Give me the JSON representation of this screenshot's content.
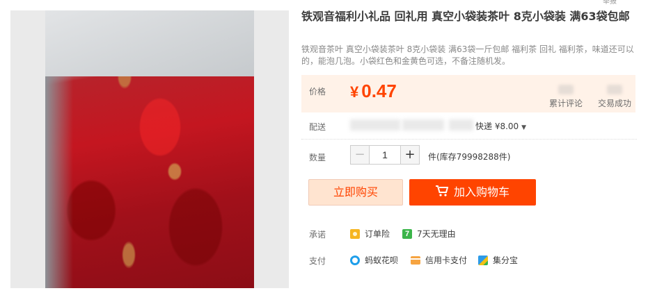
{
  "product": {
    "title": "铁观音福利小礼品 回礼用 真空小袋装茶叶 8克小袋装 满63袋包邮",
    "subtitle": "铁观音茶叶 真空小袋装茶叶 8克小袋装 满63袋一斤包邮 福利茶 回礼 福利茶，味道还可以的，能泡几泡。小袋红色和金黄色可选，不备注随机发。"
  },
  "price": {
    "label": "价格",
    "currency": "¥",
    "value": "0.47"
  },
  "stats": {
    "reviews_label": "累计评论",
    "sales_label": "交易成功"
  },
  "shipping": {
    "label": "配送",
    "fee": "快递 ¥8.00"
  },
  "quantity": {
    "label": "数量",
    "minus": "−",
    "plus": "+",
    "value": "1",
    "stock_text": "件(库存79998288件)"
  },
  "actions": {
    "buy_now": "立即购买",
    "add_to_cart": "加入购物车"
  },
  "promise": {
    "label": "承诺",
    "items": [
      "订单险",
      "7天无理由"
    ]
  },
  "payment": {
    "label": "支付",
    "items": [
      "蚂蚁花呗",
      "信用卡支付",
      "集分宝"
    ]
  },
  "corner": "举报",
  "colors": {
    "accent": "#ff4400",
    "price_bg": "#fff2e8",
    "buy_bg": "#ffe4d0"
  }
}
